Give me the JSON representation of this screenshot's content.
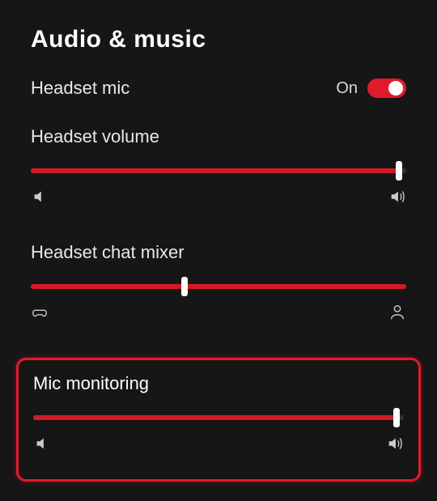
{
  "title": "Audio & music",
  "headset_mic": {
    "label": "Headset mic",
    "state_text": "On",
    "on": true
  },
  "headset_volume": {
    "label": "Headset volume",
    "value_pct": 98
  },
  "chat_mixer": {
    "label": "Headset chat mixer",
    "value_pct": 41
  },
  "mic_monitoring": {
    "label": "Mic monitoring",
    "value_pct": 98
  }
}
